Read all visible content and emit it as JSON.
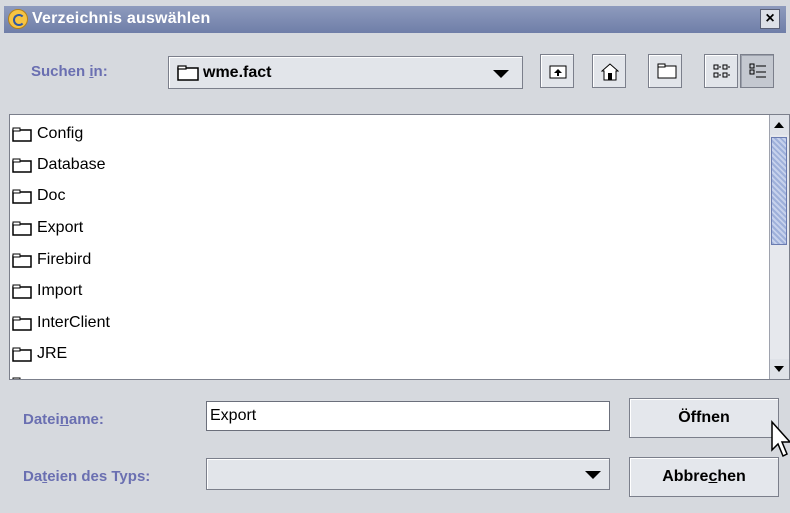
{
  "window": {
    "title": "Verzeichnis auswählen",
    "close_glyph": "×"
  },
  "look_in": {
    "label_pre": "Suchen ",
    "label_mn": "i",
    "label_post": "n:",
    "value": "wme.fact"
  },
  "toolbar": {
    "icons": [
      "up-folder-icon",
      "home-icon",
      "new-folder-icon",
      "list-view-icon",
      "details-view-icon"
    ]
  },
  "files": [
    "Config",
    "Database",
    "Doc",
    "Export",
    "Firebird",
    "Import",
    "InterClient",
    "JRE"
  ],
  "filename": {
    "label_pre": "Datei",
    "label_mn": "n",
    "label_post": "ame:",
    "value": "Export"
  },
  "filetype": {
    "label_pre": "Da",
    "label_mn": "t",
    "label_post": "eien des Typs:",
    "value": ""
  },
  "buttons": {
    "open": "Öffnen",
    "cancel_pre": "Abbre",
    "cancel_mn": "c",
    "cancel_post": "hen"
  }
}
